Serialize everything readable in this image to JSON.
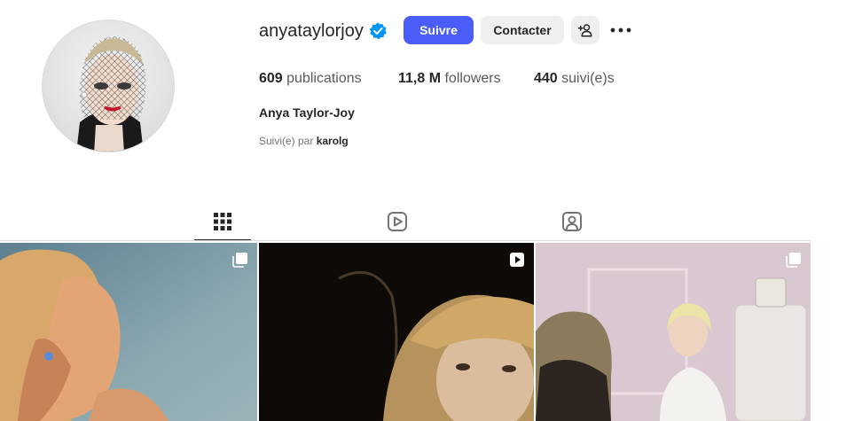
{
  "profile": {
    "username": "anyataylorjoy",
    "verified_icon": "verified-badge-icon",
    "follow_label": "Suivre",
    "contact_label": "Contacter",
    "add_user_icon": "person-add-icon",
    "more_icon": "more-horizontal-icon",
    "full_name": "Anya Taylor-Joy",
    "followed_by_prefix": "Suivi(e) par",
    "followed_by_user": "karolg",
    "accent_color": "#4a5df9",
    "verified_color": "#0095f6"
  },
  "stats": {
    "posts_count": "609",
    "posts_label": "publications",
    "followers_count": "11,8 M",
    "followers_label": "followers",
    "following_count": "440",
    "following_label": "suivi(e)s"
  },
  "tabs": [
    {
      "icon": "grid-icon",
      "active": true
    },
    {
      "icon": "reels-icon",
      "active": false
    },
    {
      "icon": "tagged-icon",
      "active": false
    }
  ],
  "posts": [
    {
      "type": "carousel",
      "badge_icon": "carousel-icon"
    },
    {
      "type": "reel",
      "badge_icon": "reel-icon"
    },
    {
      "type": "carousel",
      "badge_icon": "carousel-icon"
    }
  ]
}
